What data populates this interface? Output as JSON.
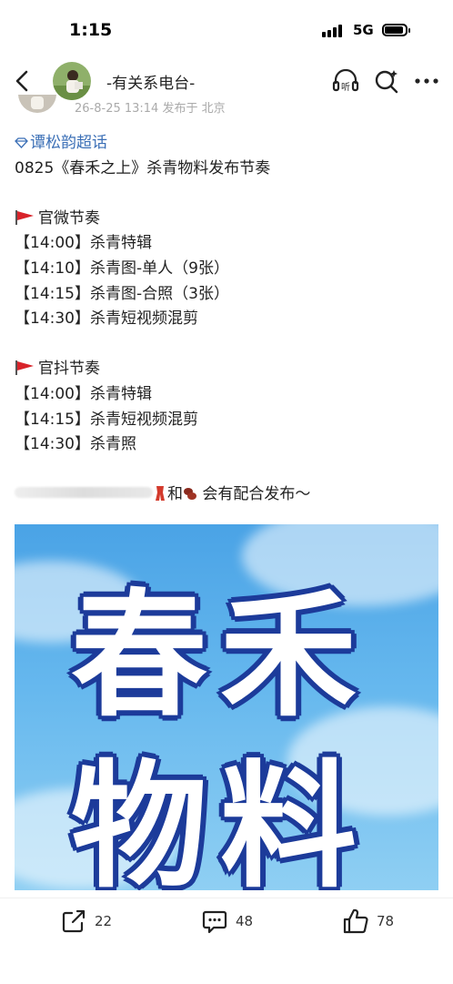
{
  "status": {
    "time": "1:15",
    "network": "5G"
  },
  "header": {
    "title": "-有关系电台-",
    "icons": [
      "back-icon",
      "listen-icon",
      "search-icon",
      "more-icon"
    ],
    "listen_label": "听"
  },
  "post": {
    "meta": "26-8-25 13:14  发布于 北京",
    "supertopic": "谭松韵超话",
    "title": "0825《春禾之上》杀青物料发布节奏",
    "sections": [
      {
        "heading": "官微节奏",
        "items": [
          "【14:00】杀青特辑",
          "【14:10】杀青图-单人（9张）",
          "【14:15】杀青图-合照（3张）",
          "【14:30】杀青短视频混剪"
        ]
      },
      {
        "heading": "官抖节奏",
        "items": [
          "【14:00】杀青特辑",
          "【14:15】杀青短视频混剪",
          "【14:30】杀青照"
        ]
      }
    ],
    "footer_and": "和",
    "footer_text": " 会有配合发布～",
    "image_text_line1": "春禾",
    "image_text_line2": "物料"
  },
  "actions": {
    "share_count": "22",
    "comment_count": "48",
    "like_count": "78"
  },
  "colors": {
    "link": "#3b6fb6",
    "flag": "#d8232a",
    "image_sky": "#4aa3e6",
    "image_outline": "#1c3b9a"
  }
}
